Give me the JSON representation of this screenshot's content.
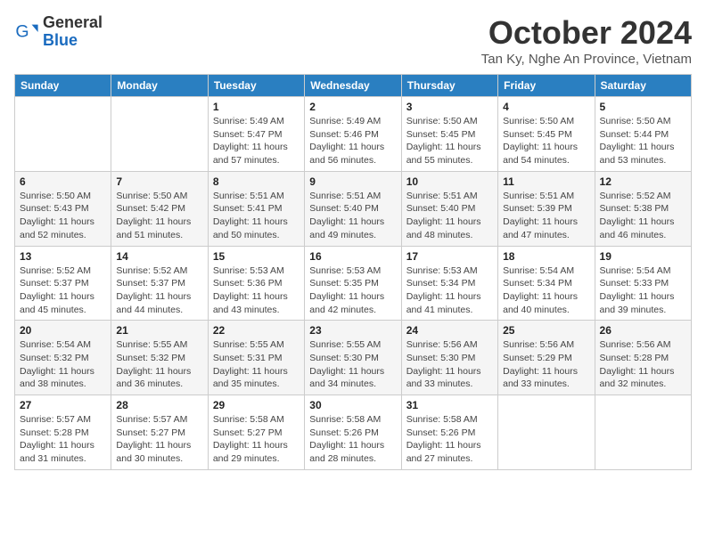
{
  "logo": {
    "general": "General",
    "blue": "Blue"
  },
  "title": "October 2024",
  "location": "Tan Ky, Nghe An Province, Vietnam",
  "header_days": [
    "Sunday",
    "Monday",
    "Tuesday",
    "Wednesday",
    "Thursday",
    "Friday",
    "Saturday"
  ],
  "weeks": [
    [
      {
        "day": "",
        "info": ""
      },
      {
        "day": "",
        "info": ""
      },
      {
        "day": "1",
        "info": "Sunrise: 5:49 AM\nSunset: 5:47 PM\nDaylight: 11 hours and 57 minutes."
      },
      {
        "day": "2",
        "info": "Sunrise: 5:49 AM\nSunset: 5:46 PM\nDaylight: 11 hours and 56 minutes."
      },
      {
        "day": "3",
        "info": "Sunrise: 5:50 AM\nSunset: 5:45 PM\nDaylight: 11 hours and 55 minutes."
      },
      {
        "day": "4",
        "info": "Sunrise: 5:50 AM\nSunset: 5:45 PM\nDaylight: 11 hours and 54 minutes."
      },
      {
        "day": "5",
        "info": "Sunrise: 5:50 AM\nSunset: 5:44 PM\nDaylight: 11 hours and 53 minutes."
      }
    ],
    [
      {
        "day": "6",
        "info": "Sunrise: 5:50 AM\nSunset: 5:43 PM\nDaylight: 11 hours and 52 minutes."
      },
      {
        "day": "7",
        "info": "Sunrise: 5:50 AM\nSunset: 5:42 PM\nDaylight: 11 hours and 51 minutes."
      },
      {
        "day": "8",
        "info": "Sunrise: 5:51 AM\nSunset: 5:41 PM\nDaylight: 11 hours and 50 minutes."
      },
      {
        "day": "9",
        "info": "Sunrise: 5:51 AM\nSunset: 5:40 PM\nDaylight: 11 hours and 49 minutes."
      },
      {
        "day": "10",
        "info": "Sunrise: 5:51 AM\nSunset: 5:40 PM\nDaylight: 11 hours and 48 minutes."
      },
      {
        "day": "11",
        "info": "Sunrise: 5:51 AM\nSunset: 5:39 PM\nDaylight: 11 hours and 47 minutes."
      },
      {
        "day": "12",
        "info": "Sunrise: 5:52 AM\nSunset: 5:38 PM\nDaylight: 11 hours and 46 minutes."
      }
    ],
    [
      {
        "day": "13",
        "info": "Sunrise: 5:52 AM\nSunset: 5:37 PM\nDaylight: 11 hours and 45 minutes."
      },
      {
        "day": "14",
        "info": "Sunrise: 5:52 AM\nSunset: 5:37 PM\nDaylight: 11 hours and 44 minutes."
      },
      {
        "day": "15",
        "info": "Sunrise: 5:53 AM\nSunset: 5:36 PM\nDaylight: 11 hours and 43 minutes."
      },
      {
        "day": "16",
        "info": "Sunrise: 5:53 AM\nSunset: 5:35 PM\nDaylight: 11 hours and 42 minutes."
      },
      {
        "day": "17",
        "info": "Sunrise: 5:53 AM\nSunset: 5:34 PM\nDaylight: 11 hours and 41 minutes."
      },
      {
        "day": "18",
        "info": "Sunrise: 5:54 AM\nSunset: 5:34 PM\nDaylight: 11 hours and 40 minutes."
      },
      {
        "day": "19",
        "info": "Sunrise: 5:54 AM\nSunset: 5:33 PM\nDaylight: 11 hours and 39 minutes."
      }
    ],
    [
      {
        "day": "20",
        "info": "Sunrise: 5:54 AM\nSunset: 5:32 PM\nDaylight: 11 hours and 38 minutes."
      },
      {
        "day": "21",
        "info": "Sunrise: 5:55 AM\nSunset: 5:32 PM\nDaylight: 11 hours and 36 minutes."
      },
      {
        "day": "22",
        "info": "Sunrise: 5:55 AM\nSunset: 5:31 PM\nDaylight: 11 hours and 35 minutes."
      },
      {
        "day": "23",
        "info": "Sunrise: 5:55 AM\nSunset: 5:30 PM\nDaylight: 11 hours and 34 minutes."
      },
      {
        "day": "24",
        "info": "Sunrise: 5:56 AM\nSunset: 5:30 PM\nDaylight: 11 hours and 33 minutes."
      },
      {
        "day": "25",
        "info": "Sunrise: 5:56 AM\nSunset: 5:29 PM\nDaylight: 11 hours and 33 minutes."
      },
      {
        "day": "26",
        "info": "Sunrise: 5:56 AM\nSunset: 5:28 PM\nDaylight: 11 hours and 32 minutes."
      }
    ],
    [
      {
        "day": "27",
        "info": "Sunrise: 5:57 AM\nSunset: 5:28 PM\nDaylight: 11 hours and 31 minutes."
      },
      {
        "day": "28",
        "info": "Sunrise: 5:57 AM\nSunset: 5:27 PM\nDaylight: 11 hours and 30 minutes."
      },
      {
        "day": "29",
        "info": "Sunrise: 5:58 AM\nSunset: 5:27 PM\nDaylight: 11 hours and 29 minutes."
      },
      {
        "day": "30",
        "info": "Sunrise: 5:58 AM\nSunset: 5:26 PM\nDaylight: 11 hours and 28 minutes."
      },
      {
        "day": "31",
        "info": "Sunrise: 5:58 AM\nSunset: 5:26 PM\nDaylight: 11 hours and 27 minutes."
      },
      {
        "day": "",
        "info": ""
      },
      {
        "day": "",
        "info": ""
      }
    ]
  ]
}
